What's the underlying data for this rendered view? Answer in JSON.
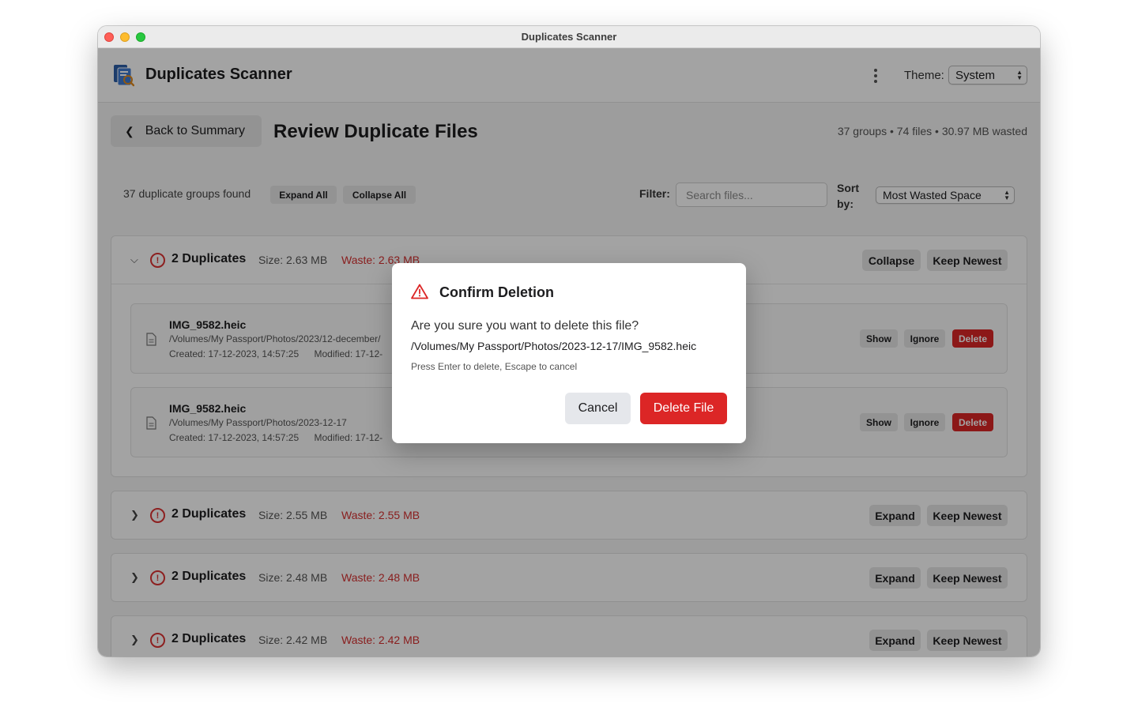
{
  "window": {
    "title": "Duplicates Scanner"
  },
  "header": {
    "app_title": "Duplicates Scanner",
    "theme_label": "Theme:",
    "theme_value": "System"
  },
  "toolbar": {
    "back_label": "Back to Summary",
    "page_title": "Review Duplicate Files",
    "summary": "37 groups • 74 files • 30.97 MB wasted"
  },
  "controls": {
    "groups_found": "37 duplicate groups found",
    "expand_all": "Expand All",
    "collapse_all": "Collapse All",
    "filter_label": "Filter:",
    "search_placeholder": "Search files...",
    "sort_label": "Sort by:",
    "sort_value": "Most Wasted Space"
  },
  "groups": [
    {
      "title": "2 Duplicates",
      "size": "Size: 2.63 MB",
      "waste": "Waste: 2.63 MB",
      "toggle": "Collapse",
      "keep": "Keep Newest",
      "files": [
        {
          "name": "IMG_9582.heic",
          "path": "/Volumes/My Passport/Photos/2023/12-december/",
          "created": "Created: 17-12-2023, 14:57:25",
          "modified": "Modified: 17-12-",
          "show": "Show",
          "ignore": "Ignore",
          "delete": "Delete"
        },
        {
          "name": "IMG_9582.heic",
          "path": "/Volumes/My Passport/Photos/2023-12-17",
          "created": "Created: 17-12-2023, 14:57:25",
          "modified": "Modified: 17-12-",
          "show": "Show",
          "ignore": "Ignore",
          "delete": "Delete"
        }
      ]
    },
    {
      "title": "2 Duplicates",
      "size": "Size: 2.55 MB",
      "waste": "Waste: 2.55 MB",
      "toggle": "Expand",
      "keep": "Keep Newest"
    },
    {
      "title": "2 Duplicates",
      "size": "Size: 2.48 MB",
      "waste": "Waste: 2.48 MB",
      "toggle": "Expand",
      "keep": "Keep Newest"
    },
    {
      "title": "2 Duplicates",
      "size": "Size: 2.42 MB",
      "waste": "Waste: 2.42 MB",
      "toggle": "Expand",
      "keep": "Keep Newest"
    }
  ],
  "dialog": {
    "title": "Confirm Deletion",
    "question": "Are you sure you want to delete this file?",
    "path": "/Volumes/My Passport/Photos/2023-12-17/IMG_9582.heic",
    "hint": "Press Enter to delete, Escape to cancel",
    "cancel": "Cancel",
    "confirm": "Delete File"
  },
  "colors": {
    "danger": "#dc2626",
    "waste_text": "#d63030",
    "traffic_close": "#ff5f57",
    "traffic_min": "#febc2e",
    "traffic_max": "#28c840"
  },
  "icons": [
    "app-logo-icon",
    "kebab-menu-icon",
    "chevron-left-icon",
    "chevron-down-icon",
    "chevron-right-icon",
    "alert-circle-icon",
    "document-icon",
    "warning-triangle-icon"
  ]
}
